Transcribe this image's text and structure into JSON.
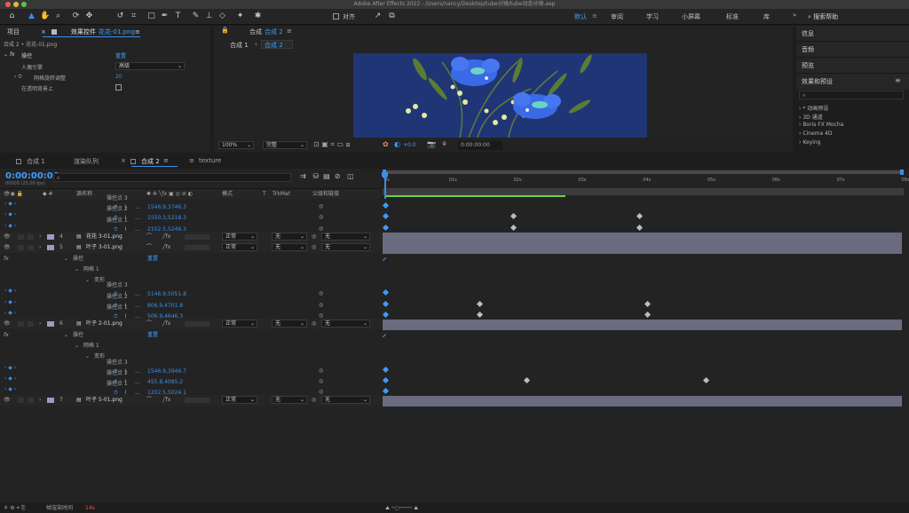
{
  "titlebar": {
    "title": "Adobe After Effects 2022 - /Users/nancy/Desktop/tube分镜/tube动态分镜.aep"
  },
  "toolbar": {
    "align_label": "对齐",
    "workspaces": [
      "默认",
      "审阅",
      "学习",
      "小屏幕",
      "标准",
      "库"
    ],
    "search_help": "搜索帮助"
  },
  "left": {
    "tab_project": "项目",
    "tab_effects": "效果控件",
    "effects_file": "花花-01.png",
    "crumb": "合成 2 • 花花-01.png",
    "effect_name": "操控",
    "reset": "重置",
    "rows": [
      {
        "label": "人偶引擎",
        "value": "高级"
      },
      {
        "label": "网格旋转调整",
        "value": "20"
      },
      {
        "label": "在透明背景上",
        "value": ""
      }
    ]
  },
  "comp": {
    "label": "合成",
    "name": "合成 2",
    "crumb1": "合成 1",
    "crumb2": "合成 2",
    "zoom": "100%",
    "quality": "完整",
    "exposure": "+0.0",
    "time": "0:00:00:00"
  },
  "right": {
    "panels": [
      "信息",
      "音频",
      "预览",
      "效果和预设"
    ],
    "effects": [
      "* 动画预设",
      "3D 通道",
      "Boris FX Mocha",
      "Cinema 4D",
      "Keying"
    ]
  },
  "timeline_tabs": [
    "合成 1",
    "渲染队列",
    "合成 2",
    "texture"
  ],
  "timeline": {
    "timecode": "0:00:00:00",
    "fps": "00000 (25.00 fps)",
    "col_name": "源名称",
    "col_mode": "模式",
    "col_t": "T",
    "col_trk": "TrkMat",
    "col_parent": "父级和链接",
    "ruler": [
      "0s",
      "01s",
      "02s",
      "03s",
      "04s",
      "05s",
      "06s",
      "07s",
      "08s"
    ],
    "footer": "帧渲染时间",
    "footer_val": "14s"
  },
  "rows": [
    {
      "type": "pin",
      "label": "操控点 3",
      "value": "1546.9,3746.3"
    },
    {
      "type": "pin",
      "label": "操控点 2",
      "value": "1550.3,5218.3"
    },
    {
      "type": "pin",
      "label": "操控点 1",
      "value": "2152.5,5246.3"
    },
    {
      "type": "layer",
      "num": "4",
      "name": "花花 3-01.png",
      "mode": "正常",
      "trk": "无",
      "parent": "无"
    },
    {
      "type": "layer",
      "num": "5",
      "name": "叶子 3-01.png",
      "mode": "正常",
      "trk": "无",
      "parent": "无"
    },
    {
      "type": "fx",
      "label": "操控",
      "reset": "重置"
    },
    {
      "type": "sub",
      "label": "网格 1"
    },
    {
      "type": "sub2",
      "label": "变形"
    },
    {
      "type": "pin",
      "label": "操控点 3",
      "value": "5146.9,5051.8"
    },
    {
      "type": "pin",
      "label": "操控点 2",
      "value": "806.9,4701.8"
    },
    {
      "type": "pin",
      "label": "操控点 1",
      "value": "506.9,4646.3"
    },
    {
      "type": "layer",
      "num": "6",
      "name": "叶子 2-01.png",
      "mode": "正常",
      "trk": "无",
      "parent": "无"
    },
    {
      "type": "fx",
      "label": "操控",
      "reset": "重置"
    },
    {
      "type": "sub",
      "label": "网格 1"
    },
    {
      "type": "sub2",
      "label": "变形"
    },
    {
      "type": "pin",
      "label": "操控点 3",
      "value": "1546.9,3946.7"
    },
    {
      "type": "pin",
      "label": "操控点 2",
      "value": "455.8,4085.2"
    },
    {
      "type": "pin",
      "label": "操控点 1",
      "value": "1202.5,5024.1"
    },
    {
      "type": "layer",
      "num": "7",
      "name": "叶子 5-01.png",
      "mode": "正常",
      "trk": "无",
      "parent": "无"
    }
  ],
  "colors": {
    "accent": "#3a8ee6",
    "layerbar": "#6a6b7e",
    "comp_bg": "#1f3576"
  }
}
